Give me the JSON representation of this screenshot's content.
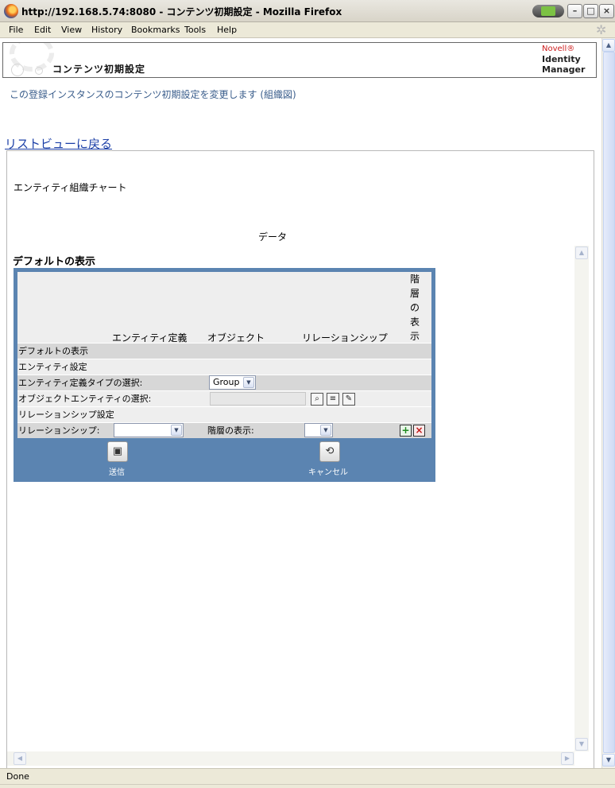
{
  "window": {
    "title": "http://192.168.5.74:8080 - コンテンツ初期設定 - Mozilla Firefox",
    "controls": {
      "minimize": "–",
      "maximize": "□",
      "close": "×"
    }
  },
  "menu": [
    "File",
    "Edit",
    "View",
    "History",
    "Bookmarks",
    "Tools",
    "Help"
  ],
  "banner": {
    "title": "コンテンツ初期設定",
    "brand_novell": "Novell®",
    "brand_line1": "Identity",
    "brand_line2": "Manager"
  },
  "description": "この登録インスタンスのコンテンツ初期設定を変更します (組織図)",
  "back_link": "リストビューに戻る",
  "entity_chart_label": "エンティティ組織チャート",
  "data_label": "データ",
  "section_title": "デフォルトの表示",
  "table": {
    "headers": [
      "エンティティ定義",
      "オブジェクト",
      "リレーションシップ"
    ],
    "header_vertical": [
      "階",
      "層",
      "の",
      "表",
      "示"
    ],
    "rows": {
      "default_display": "デフォルトの表示",
      "entity_settings": "エンティティ設定",
      "entity_def_type": "エンティティ定義タイプの選択:",
      "entity_def_type_value": "Group",
      "object_entity": "オブジェクトエンティティの選択:",
      "relationship_settings": "リレーションシップ設定",
      "relationship": "リレーションシップ:",
      "hierarchy_display": "階層の表示:"
    }
  },
  "actions": {
    "submit": "送信",
    "cancel": "キャンセル"
  },
  "status": "Done",
  "colors": {
    "panel": "#5b84b1",
    "link": "#1b3fa7",
    "desc": "#3b5e8c"
  }
}
